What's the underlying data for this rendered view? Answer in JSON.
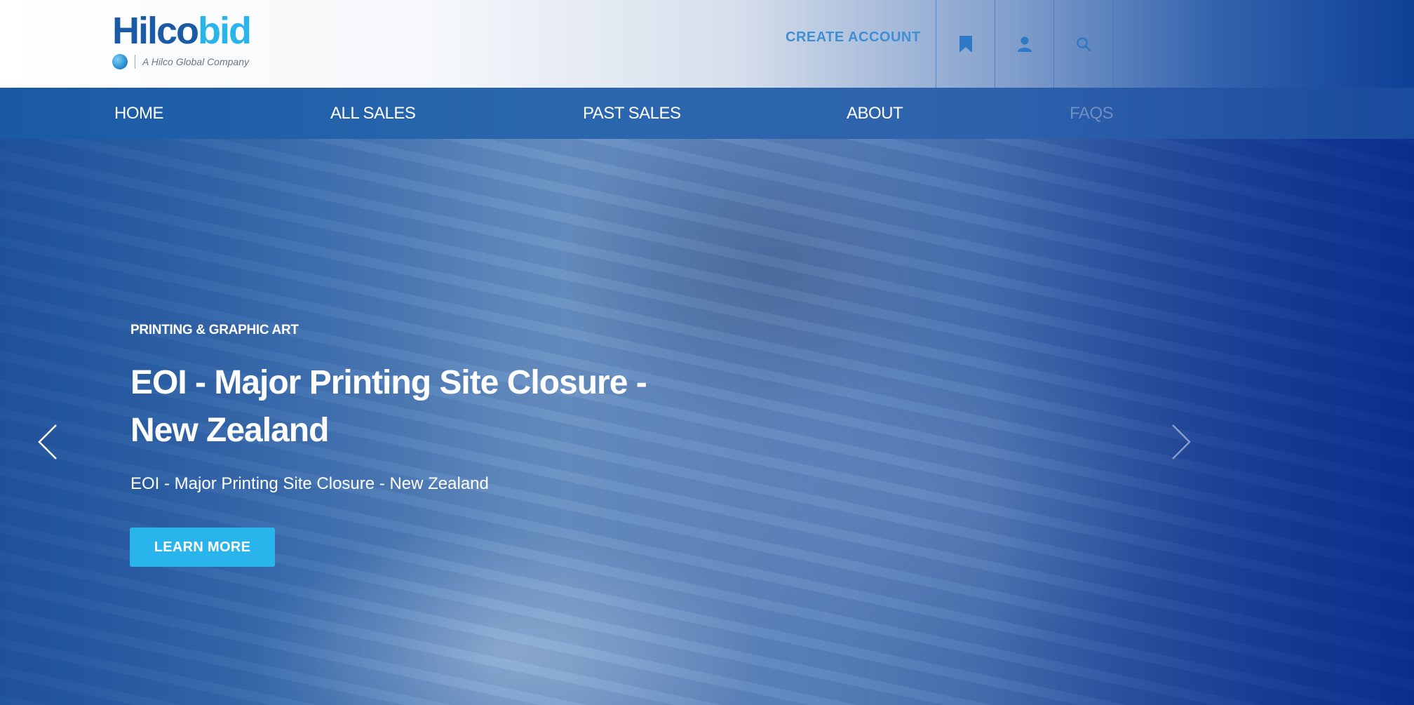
{
  "header": {
    "logo": {
      "brand_main": "Hilco",
      "brand_accent": "bid",
      "tagline": "A Hilco Global Company"
    },
    "create_account_label": "CREATE ACCOUNT",
    "icons": [
      "bookmark-icon",
      "user-icon",
      "search-icon"
    ]
  },
  "nav": {
    "items": [
      {
        "label": "HOME"
      },
      {
        "label": "ALL SALES"
      },
      {
        "label": "PAST SALES"
      },
      {
        "label": "ABOUT"
      },
      {
        "label": "FAQS"
      }
    ]
  },
  "hero": {
    "category": "PRINTING & GRAPHIC ART",
    "title": "EOI - Major Printing Site Closure - New Zealand",
    "subtitle": "EOI - Major Printing Site Closure - New Zealand",
    "cta_label": "LEARN MORE"
  },
  "colors": {
    "brand_blue": "#1b5ba6",
    "brand_cyan": "#2ab4ec",
    "nav_blue": "#2a67ae"
  }
}
